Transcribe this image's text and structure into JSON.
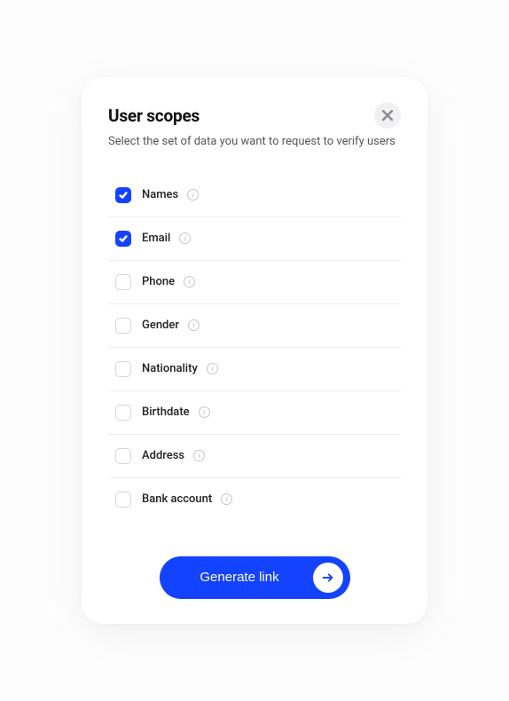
{
  "header": {
    "title": "User scopes",
    "subtitle": "Select the set of data you want to request to verify users"
  },
  "scopes": [
    {
      "label": "Names",
      "checked": true
    },
    {
      "label": "Email",
      "checked": true
    },
    {
      "label": "Phone",
      "checked": false
    },
    {
      "label": "Gender",
      "checked": false
    },
    {
      "label": "Nationality",
      "checked": false
    },
    {
      "label": "Birthdate",
      "checked": false
    },
    {
      "label": "Address",
      "checked": false
    },
    {
      "label": "Bank account",
      "checked": false
    }
  ],
  "actions": {
    "generate": "Generate link"
  },
  "colors": {
    "primary": "#1443ff"
  }
}
